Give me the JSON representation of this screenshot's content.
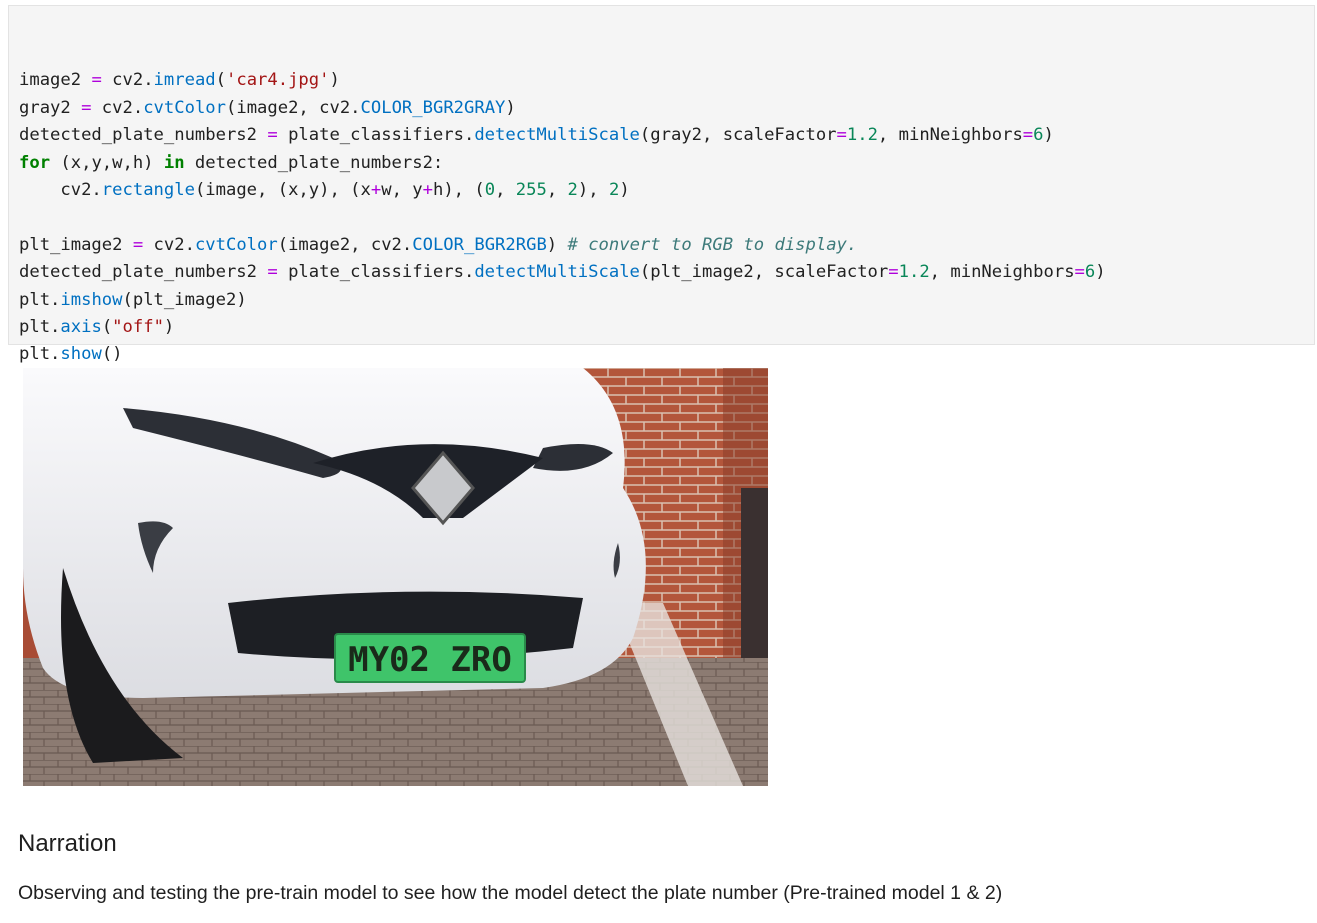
{
  "code_cell": {
    "lines": [
      [
        {
          "t": "",
          "c": ""
        }
      ],
      [
        {
          "t": "image2 ",
          "c": ""
        },
        {
          "t": "=",
          "c": "op"
        },
        {
          "t": " cv2.",
          "c": ""
        },
        {
          "t": "imread",
          "c": "fn"
        },
        {
          "t": "(",
          "c": ""
        },
        {
          "t": "'car4.jpg'",
          "c": "str"
        },
        {
          "t": ")",
          "c": ""
        }
      ],
      [
        {
          "t": "gray2 ",
          "c": ""
        },
        {
          "t": "=",
          "c": "op"
        },
        {
          "t": " cv2.",
          "c": ""
        },
        {
          "t": "cvtColor",
          "c": "fn"
        },
        {
          "t": "(image2, cv2.",
          "c": ""
        },
        {
          "t": "COLOR_BGR2GRAY",
          "c": "fn"
        },
        {
          "t": ")",
          "c": ""
        }
      ],
      [
        {
          "t": "detected_plate_numbers2 ",
          "c": ""
        },
        {
          "t": "=",
          "c": "op"
        },
        {
          "t": " plate_classifiers.",
          "c": ""
        },
        {
          "t": "detectMultiScale",
          "c": "fn"
        },
        {
          "t": "(gray2, scaleFactor",
          "c": ""
        },
        {
          "t": "=",
          "c": "op"
        },
        {
          "t": "1.2",
          "c": "num"
        },
        {
          "t": ", minNeighbors",
          "c": ""
        },
        {
          "t": "=",
          "c": "op"
        },
        {
          "t": "6",
          "c": "num"
        },
        {
          "t": ")",
          "c": ""
        }
      ],
      [
        {
          "t": "for",
          "c": "kw"
        },
        {
          "t": " (x,y,w,h) ",
          "c": ""
        },
        {
          "t": "in",
          "c": "kw"
        },
        {
          "t": " detected_plate_numbers2:",
          "c": ""
        }
      ],
      [
        {
          "t": "    cv2.",
          "c": ""
        },
        {
          "t": "rectangle",
          "c": "fn"
        },
        {
          "t": "(image, (x,y), (x",
          "c": ""
        },
        {
          "t": "+",
          "c": "op"
        },
        {
          "t": "w, y",
          "c": ""
        },
        {
          "t": "+",
          "c": "op"
        },
        {
          "t": "h), (",
          "c": ""
        },
        {
          "t": "0",
          "c": "num"
        },
        {
          "t": ", ",
          "c": ""
        },
        {
          "t": "255",
          "c": "num"
        },
        {
          "t": ", ",
          "c": ""
        },
        {
          "t": "2",
          "c": "num"
        },
        {
          "t": "), ",
          "c": ""
        },
        {
          "t": "2",
          "c": "num"
        },
        {
          "t": ")",
          "c": ""
        }
      ],
      [
        {
          "t": "",
          "c": ""
        }
      ],
      [
        {
          "t": "plt_image2 ",
          "c": ""
        },
        {
          "t": "=",
          "c": "op"
        },
        {
          "t": " cv2.",
          "c": ""
        },
        {
          "t": "cvtColor",
          "c": "fn"
        },
        {
          "t": "(image2, cv2.",
          "c": ""
        },
        {
          "t": "COLOR_BGR2RGB",
          "c": "fn"
        },
        {
          "t": ") ",
          "c": ""
        },
        {
          "t": "# convert to RGB to display.",
          "c": "cm"
        }
      ],
      [
        {
          "t": "detected_plate_numbers2 ",
          "c": ""
        },
        {
          "t": "=",
          "c": "op"
        },
        {
          "t": " plate_classifiers.",
          "c": ""
        },
        {
          "t": "detectMultiScale",
          "c": "fn"
        },
        {
          "t": "(plt_image2, scaleFactor",
          "c": ""
        },
        {
          "t": "=",
          "c": "op"
        },
        {
          "t": "1.2",
          "c": "num"
        },
        {
          "t": ", minNeighbors",
          "c": ""
        },
        {
          "t": "=",
          "c": "op"
        },
        {
          "t": "6",
          "c": "num"
        },
        {
          "t": ")",
          "c": ""
        }
      ],
      [
        {
          "t": "plt.",
          "c": ""
        },
        {
          "t": "imshow",
          "c": "fn"
        },
        {
          "t": "(plt_image2)",
          "c": ""
        }
      ],
      [
        {
          "t": "plt.",
          "c": ""
        },
        {
          "t": "axis",
          "c": "fn"
        },
        {
          "t": "(",
          "c": ""
        },
        {
          "t": "\"off\"",
          "c": "str"
        },
        {
          "t": ")",
          "c": ""
        }
      ],
      [
        {
          "t": "plt.",
          "c": ""
        },
        {
          "t": "show",
          "c": "fn"
        },
        {
          "t": "()",
          "c": ""
        }
      ]
    ]
  },
  "output_image": {
    "plate_text": "MY02 ZRO",
    "colors": {
      "plate": "#3fc46a",
      "car": "#f2f2f4",
      "brick": "#b0543a",
      "ground": "#8e7f77"
    }
  },
  "markdown": {
    "heading": "Narration",
    "paragraph": "Observing and testing the pre-train model to see how the model detect the plate number (Pre-trained model 1 & 2)"
  }
}
